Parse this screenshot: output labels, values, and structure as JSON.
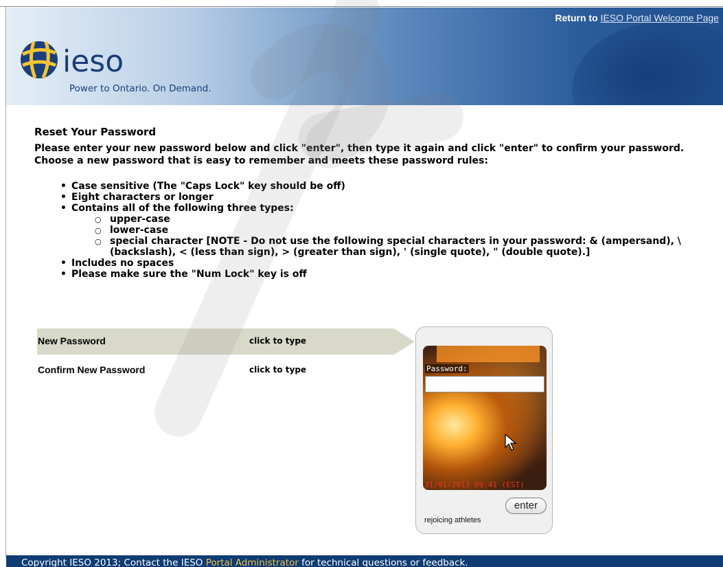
{
  "header": {
    "return_prefix": "Return to",
    "return_link": "IESO Portal Welcome Page",
    "logo_word": "ieso",
    "tagline": "Power to Ontario. On Demand."
  },
  "main": {
    "title": "Reset Your Password",
    "intro_line1": "Please enter your new password below and click \"enter\", then type it again and click \"enter\" to confirm your password.",
    "intro_line2": "Choose a new password that is easy to remember and meets these password rules:",
    "rules": [
      "Case sensitive (The \"Caps Lock\" key should be off)",
      "Eight characters or longer",
      "Contains all of the following three types:"
    ],
    "subrules": [
      "upper-case",
      "lower-case",
      "special character [NOTE - Do not use the following special characters in your password: & (ampersand), \\",
      "(backslash), < (less than sign), > (greater than sign), ' (single quote), \" (double quote).]"
    ],
    "rules_after": [
      "Includes no spaces",
      "Please make sure the \"Num Lock\" key is off"
    ],
    "bullet": "•",
    "sub_bullet": "○"
  },
  "form": {
    "new_password_label": "New Password",
    "new_password_hint": "click to type",
    "confirm_password_label": "Confirm New Password",
    "confirm_password_hint": "click to type"
  },
  "widget": {
    "password_label": "Password:",
    "timestamp": "31/01/2013 09:41 (EST)",
    "enter_label": "enter",
    "phrase": "rejoicing athletes"
  },
  "footer": {
    "prefix": "Copyright IESO 2013; Contact the IESO",
    "link": "Portal Administrator",
    "suffix": "for technical questions or feedback."
  },
  "colors": {
    "footer_bg": "#0f3c73",
    "footer_link": "#f2c341",
    "row_highlight": "#d8d9c9",
    "brand_blue": "#1a3d78"
  }
}
